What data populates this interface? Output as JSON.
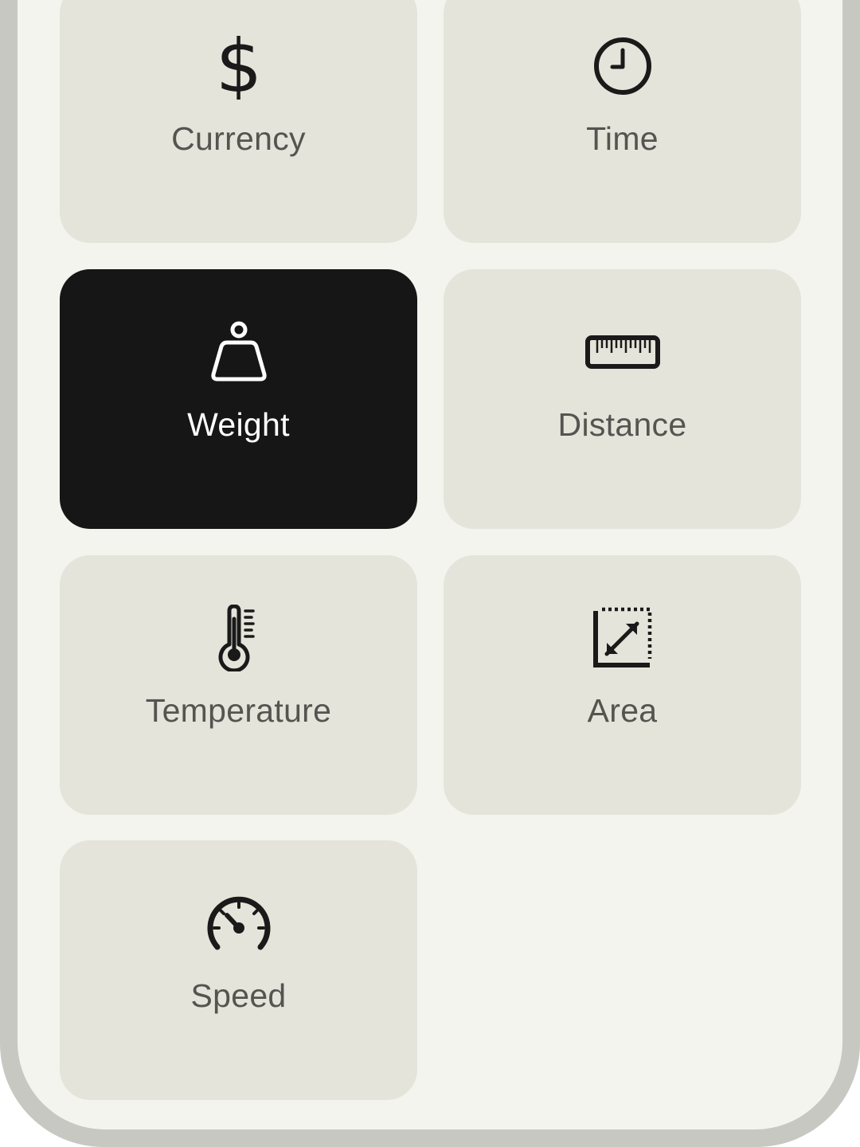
{
  "categories": [
    {
      "id": "currency",
      "label": "Currency",
      "icon": "dollar-icon",
      "active": false
    },
    {
      "id": "time",
      "label": "Time",
      "icon": "clock-icon",
      "active": false
    },
    {
      "id": "weight",
      "label": "Weight",
      "icon": "weight-icon",
      "active": true
    },
    {
      "id": "distance",
      "label": "Distance",
      "icon": "ruler-icon",
      "active": false
    },
    {
      "id": "temperature",
      "label": "Temperature",
      "icon": "thermometer-icon",
      "active": false
    },
    {
      "id": "area",
      "label": "Area",
      "icon": "area-icon",
      "active": false
    },
    {
      "id": "speed",
      "label": "Speed",
      "icon": "speedometer-icon",
      "active": false
    }
  ],
  "colors": {
    "tile": "#e4e4da",
    "tile_active": "#161616",
    "label": "#545450",
    "label_active": "#ffffff",
    "screen": "#f4f4ee",
    "frame": "#c8c8c2"
  }
}
